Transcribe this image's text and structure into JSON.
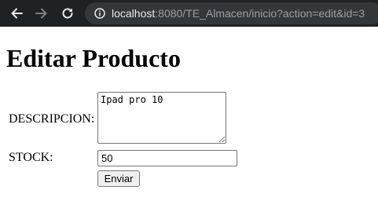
{
  "browser": {
    "url_host": "localhost",
    "url_rest": ":8080/TE_Almacen/inicio?action=edit&id=3",
    "icons": {
      "back": "arrow-left-icon",
      "forward": "arrow-right-icon",
      "reload": "reload-icon",
      "site_info": "info-icon"
    }
  },
  "page": {
    "title": "Editar Producto",
    "form": {
      "descripcion_label": "DESCRIPCION:",
      "descripcion_value": "Ipad pro 10",
      "stock_label": "STOCK:",
      "stock_value": "50",
      "submit_label": "Enviar"
    }
  }
}
